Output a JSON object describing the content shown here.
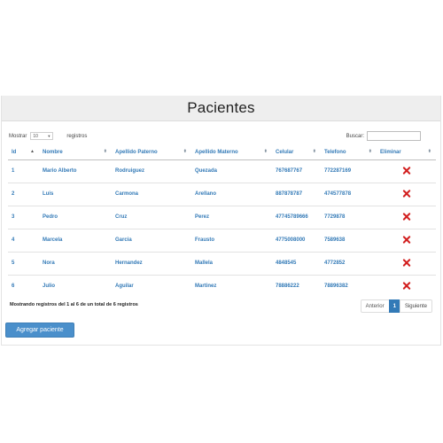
{
  "page": {
    "title": "Pacientes"
  },
  "controls": {
    "length_before": "Mostrar",
    "length_value": "10",
    "length_after": "registros",
    "search_label": "Buscar:",
    "search_value": ""
  },
  "table": {
    "columns": [
      "Id",
      "Nombre",
      "Apellido Paterno",
      "Apellido Materno",
      "Celular",
      "Telefono",
      "Eliminar"
    ],
    "rows": [
      {
        "id": "1",
        "nombre": "Mario Alberto",
        "paterno": "Rodruiguez",
        "materno": "Quezada",
        "celular": "767687767",
        "telefono": "772287169"
      },
      {
        "id": "2",
        "nombre": "Luis",
        "paterno": "Carmona",
        "materno": "Arellano",
        "celular": "887878787",
        "telefono": "474577878"
      },
      {
        "id": "3",
        "nombre": "Pedro",
        "paterno": "Cruz",
        "materno": "Perez",
        "celular": "47745789666",
        "telefono": "7729878"
      },
      {
        "id": "4",
        "nombre": "Marcela",
        "paterno": "Garcia",
        "materno": "Frausto",
        "celular": "4775008000",
        "telefono": "7589638"
      },
      {
        "id": "5",
        "nombre": "Nora",
        "paterno": "Hernandez",
        "materno": "Mallela",
        "celular": "4848545",
        "telefono": "4772852"
      },
      {
        "id": "6",
        "nombre": "Julio",
        "paterno": "Aguilar",
        "materno": "Martinez",
        "celular": "78886222",
        "telefono": "78896382"
      }
    ],
    "delete_icon": "red-x-icon"
  },
  "footer": {
    "info": "Mostrando registros del 1 al 6 de un total de 6 registros",
    "prev": "Anterior",
    "current_page": "1",
    "next": "Siguiente"
  },
  "actions": {
    "add_label": "Agregar paciente"
  },
  "colors": {
    "link": "#337ab7",
    "delete": "#d21f1f",
    "button": "#4a8fcb",
    "heading_bg": "#eeeeee"
  }
}
